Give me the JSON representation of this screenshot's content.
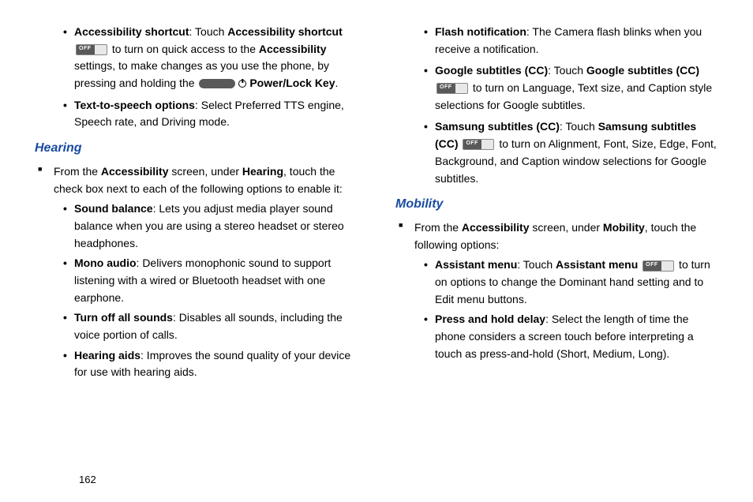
{
  "page_number": "162",
  "col1": {
    "top": {
      "item1": {
        "b1": "Accessibility shortcut",
        "t1": ": Touch ",
        "b2": "Accessibility shortcut",
        "t2": " to turn on quick access to the ",
        "b3": "Accessibility",
        "t3": " settings, to make changes as you use the phone, by pressing and holding the ",
        "b4": "Power/Lock Key",
        "t4": "."
      },
      "item2": {
        "b1": "Text-to-speech options",
        "t1": ": Select Preferred TTS engine, Speech rate, and Driving mode."
      }
    },
    "heading": "Hearing",
    "intro": {
      "t1": "From the ",
      "b1": "Accessibility",
      "t2": " screen, under ",
      "b2": "Hearing",
      "t3": ", touch the check box next to each of the following options to enable it:"
    },
    "items": {
      "i1": {
        "b": "Sound balance",
        "t": ": Lets you adjust media player sound balance when you are using a stereo headset or stereo headphones."
      },
      "i2": {
        "b": "Mono audio",
        "t": ": Delivers monophonic sound to support listening with a wired or Bluetooth headset with one earphone."
      },
      "i3": {
        "b": "Turn off all sounds",
        "t": ": Disables all sounds, including the voice portion of calls."
      },
      "i4": {
        "b": "Hearing aids",
        "t": ": Improves the sound quality of your device for use with hearing aids."
      }
    }
  },
  "col2": {
    "top": {
      "i1": {
        "b": "Flash notification",
        "t": ": The Camera flash blinks when you receive a notification."
      },
      "i2": {
        "b1": "Google subtitles (CC)",
        "t1": ": Touch ",
        "b2": "Google subtitles (CC)",
        "t2": " to turn on Language, Text size, and Caption style selections for Google subtitles."
      },
      "i3": {
        "b1": "Samsung subtitles (CC)",
        "t1": ": Touch ",
        "b2": "Samsung subtitles (CC)",
        "t2": " to turn on Alignment, Font, Size, Edge, Font, Background, and Caption window selections for Google subtitles."
      }
    },
    "heading": "Mobility",
    "intro": {
      "t1": "From the ",
      "b1": "Accessibility",
      "t2": " screen, under ",
      "b2": "Mobility",
      "t3": ", touch the following options:"
    },
    "items": {
      "i1": {
        "b1": "Assistant menu",
        "t1": ": Touch ",
        "b2": "Assistant menu",
        "t2": " to turn on options to change the Dominant hand setting and to Edit menu buttons."
      },
      "i2": {
        "b": "Press and hold delay",
        "t": ": Select the length of time the phone considers a screen touch before interpreting a touch as press-and-hold (Short, Medium, Long)."
      }
    }
  }
}
